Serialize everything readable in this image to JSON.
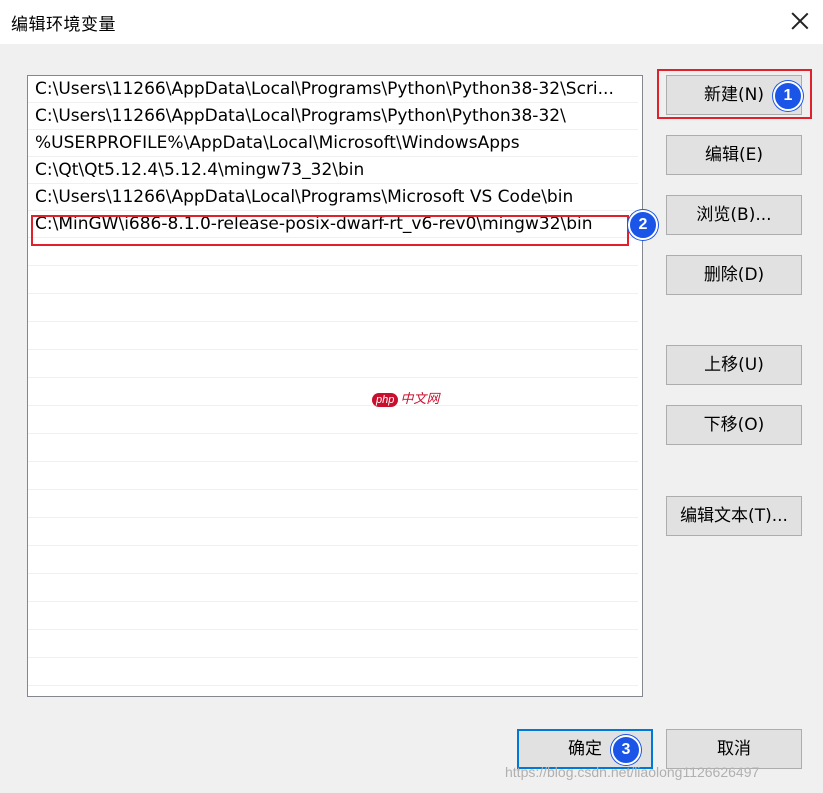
{
  "window": {
    "title": "编辑环境变量"
  },
  "list": {
    "items": [
      "C:\\Users\\11266\\AppData\\Local\\Programs\\Python\\Python38-32\\Scri...",
      "C:\\Users\\11266\\AppData\\Local\\Programs\\Python\\Python38-32\\",
      "%USERPROFILE%\\AppData\\Local\\Microsoft\\WindowsApps",
      "C:\\Qt\\Qt5.12.4\\5.12.4\\mingw73_32\\bin",
      "C:\\Users\\11266\\AppData\\Local\\Programs\\Microsoft VS Code\\bin",
      "C:\\MinGW\\i686-8.1.0-release-posix-dwarf-rt_v6-rev0\\mingw32\\bin"
    ]
  },
  "buttons": {
    "new": "新建(N)",
    "edit": "编辑(E)",
    "browse": "浏览(B)...",
    "delete": "删除(D)",
    "move_up": "上移(U)",
    "move_down": "下移(O)",
    "edit_text": "编辑文本(T)...",
    "ok": "确定",
    "cancel": "取消"
  },
  "annotations": {
    "badge1": "1",
    "badge2": "2",
    "badge3": "3"
  },
  "watermark": {
    "logo_php": "php",
    "logo_text": "中文网",
    "url": "https://blog.csdn.net/liaolong1126626497"
  },
  "colors": {
    "annotation_red": "#e0202a",
    "badge_blue": "#1a55e8",
    "default_border": "#0078d7"
  }
}
